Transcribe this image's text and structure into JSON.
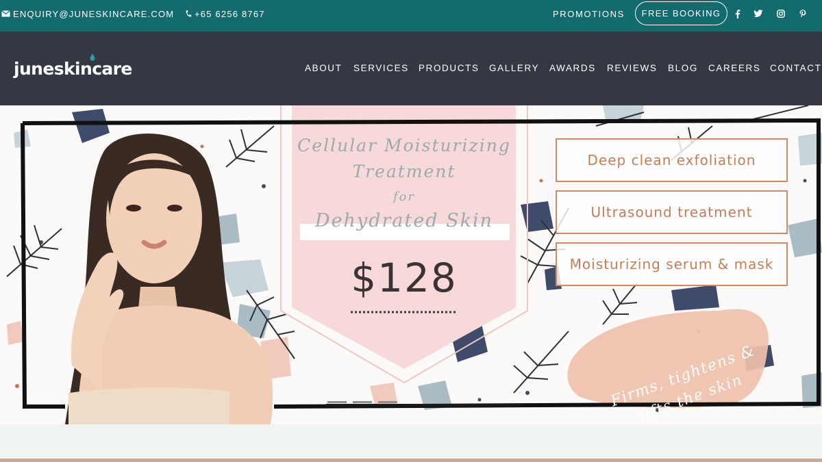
{
  "topbar": {
    "email": "ENQUIRY@JUNESKINCARE.COM",
    "phone": "+65 6256 8767",
    "promotions": "PROMOTIONS",
    "booking": "FREE BOOKING",
    "social_icons": [
      "facebook-icon",
      "twitter-icon",
      "instagram-icon",
      "pinterest-icon"
    ],
    "color": "#146b6d"
  },
  "navbar": {
    "logo": "juneskincare",
    "items": [
      "ABOUT",
      "SERVICES",
      "PRODUCTS",
      "GALLERY",
      "AWARDS",
      "REVIEWS",
      "BLOG",
      "CAREERS",
      "CONTACT"
    ],
    "color": "#333842"
  },
  "hero": {
    "title_line1": "Cellular Moisturizing",
    "title_line2": "Treatment",
    "title_for": "for",
    "title_line3": "Dehydrated Skin",
    "price": "$128",
    "features": [
      "Deep clean exfoliation",
      "Ultrasound treatment",
      "Moisturizing serum & mask"
    ],
    "tagline_line1": "Firms, tightens &",
    "tagline_line2": "lifts the skin",
    "accent": "#d18962",
    "banner_color": "#f8d9d9"
  }
}
